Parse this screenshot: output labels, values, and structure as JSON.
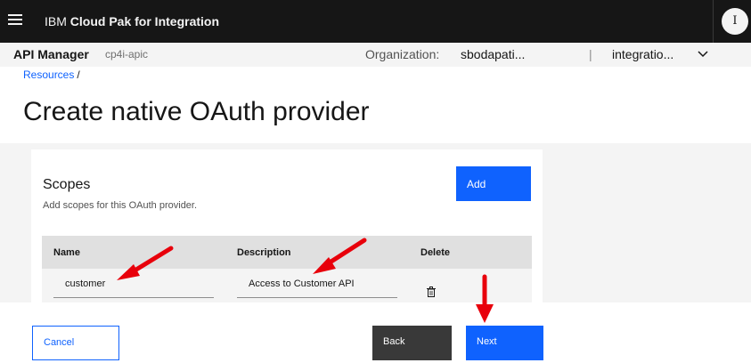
{
  "topbar": {
    "brand_prefix": "IBM ",
    "brand_name": "Cloud Pak for Integration",
    "avatar_initial": "I"
  },
  "subbar": {
    "title": "API Manager",
    "tag": "cp4i-apic",
    "org_label": "Organization:",
    "org_value": "sbodapati...",
    "separator": "|",
    "catalog_value": "integratio..."
  },
  "breadcrumb": {
    "link": "Resources",
    "slash": "/"
  },
  "page": {
    "title": "Create native OAuth provider"
  },
  "scopes": {
    "title": "Scopes",
    "description": "Add scopes for this OAuth provider.",
    "add_label": "Add",
    "columns": [
      "Name",
      "Description",
      "Delete"
    ],
    "rows": [
      {
        "name": "customer",
        "description": "Access to Customer API"
      }
    ]
  },
  "footer": {
    "cancel_label": "Cancel",
    "back_label": "Back",
    "next_label": "Next"
  },
  "annotation": {
    "arrow_color": "#e8000b"
  },
  "colors": {
    "primary": "#0f62fe",
    "topbar": "#161616"
  }
}
